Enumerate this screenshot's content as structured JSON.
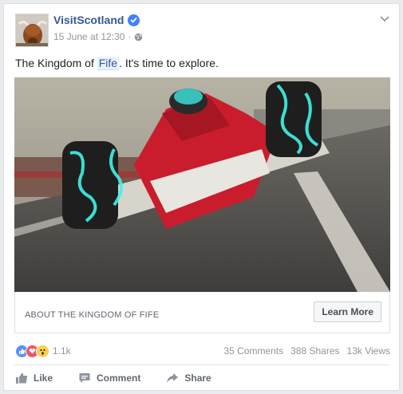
{
  "post": {
    "page_name": "VisitScotland",
    "date": "15 June at 12:30",
    "privacy_icon": "globe-icon",
    "text_before": "The Kingdom of ",
    "hashtag": "Fife",
    "text_after": ". It's time to explore."
  },
  "ad": {
    "caption": "ABOUT THE KINGDOM OF FIFE",
    "cta_label": "Learn More"
  },
  "stats": {
    "reaction_count": "1.1k",
    "comments": "35 Comments",
    "shares": "388 Shares",
    "views": "13k Views"
  },
  "actions": {
    "like": "Like",
    "comment": "Comment",
    "share": "Share"
  },
  "colors": {
    "link": "#365899",
    "verified": "#4080ff",
    "like_reaction": "#5890ff",
    "love_reaction": "#f25268",
    "wow_reaction": "#fbd052",
    "car_red": "#c91d2d",
    "glow": "#3ff3e6"
  }
}
